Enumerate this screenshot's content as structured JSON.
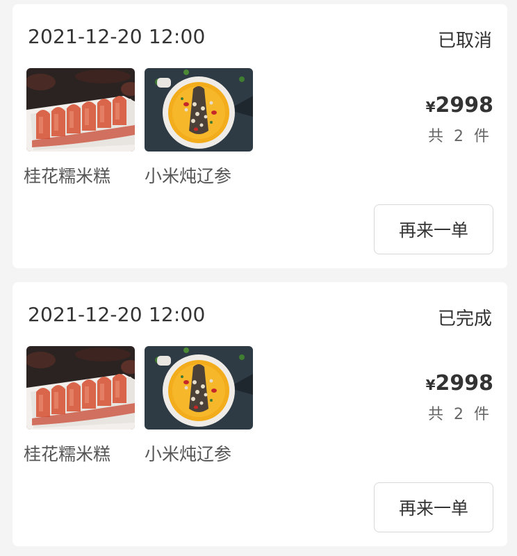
{
  "orders": [
    {
      "datetime": "2021-12-20 12:00",
      "status": "已取消",
      "items": [
        {
          "name": "桂花糯米糕",
          "image": "osmanthus-rice-cake-photo"
        },
        {
          "name": "小米炖辽参",
          "image": "millet-sea-cucumber-photo"
        }
      ],
      "currency": "¥",
      "amount": "2998",
      "count_text": "共 2 件",
      "reorder_label": "再来一单"
    },
    {
      "datetime": "2021-12-20 12:00",
      "status": "已完成",
      "items": [
        {
          "name": "桂花糯米糕",
          "image": "osmanthus-rice-cake-photo"
        },
        {
          "name": "小米炖辽参",
          "image": "millet-sea-cucumber-photo"
        }
      ],
      "currency": "¥",
      "amount": "2998",
      "count_text": "共 2 件",
      "reorder_label": "再来一单"
    }
  ]
}
